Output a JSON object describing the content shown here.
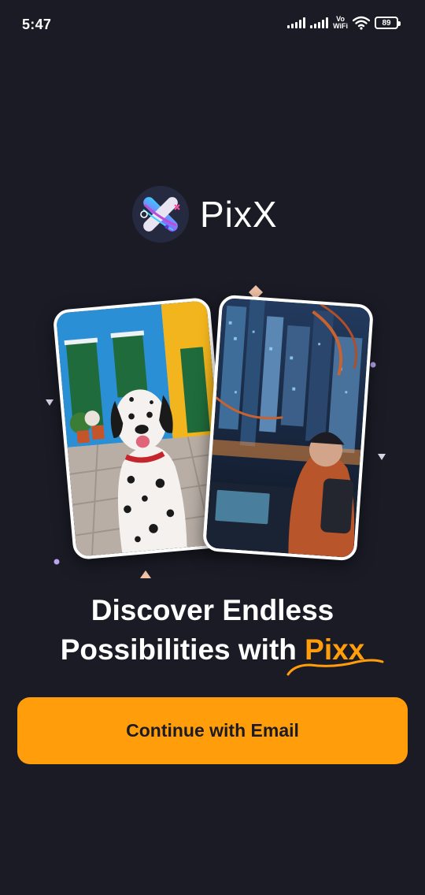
{
  "status_bar": {
    "time": "5:47",
    "network_label_top": "Vo",
    "network_label_bottom": "WiFi",
    "battery": "89",
    "icons": [
      "signal-icon",
      "signal-icon",
      "vowifi-icon",
      "wifi-icon",
      "battery-icon"
    ]
  },
  "brand": {
    "name": "PixX",
    "logo_icon": "pixx-logo-icon"
  },
  "headline": {
    "line1": "Discover Endless",
    "line2_prefix": "Possibilities with ",
    "line2_brand": "Pixx"
  },
  "actions": {
    "continue_email_label": "Continue with Email"
  },
  "colors": {
    "background": "#1b1b26",
    "accent": "#ff9d0a",
    "text": "#ffffff",
    "button_text": "#1b1b26"
  }
}
